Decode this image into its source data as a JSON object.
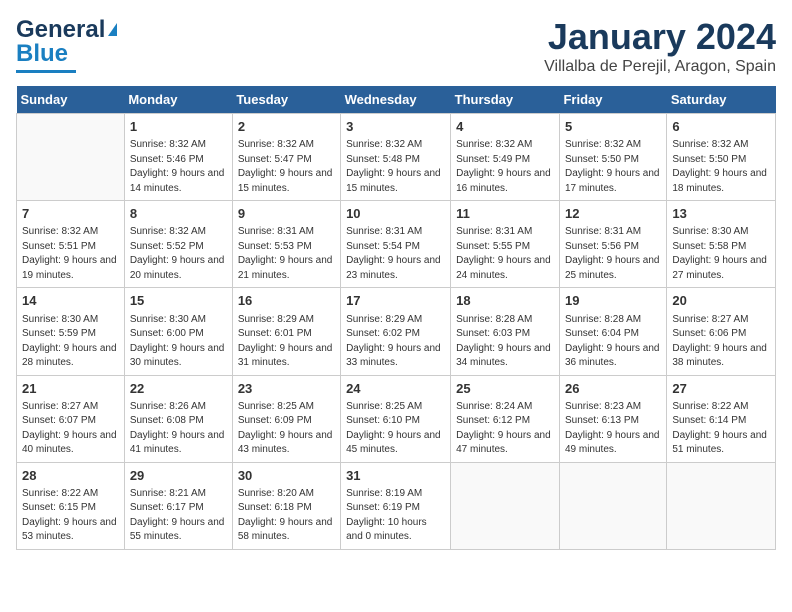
{
  "header": {
    "logo_line1": "General",
    "logo_line2": "Blue",
    "month": "January 2024",
    "location": "Villalba de Perejil, Aragon, Spain"
  },
  "days_of_week": [
    "Sunday",
    "Monday",
    "Tuesday",
    "Wednesday",
    "Thursday",
    "Friday",
    "Saturday"
  ],
  "weeks": [
    [
      {
        "day": "",
        "empty": true
      },
      {
        "day": "1",
        "sunrise": "8:32 AM",
        "sunset": "5:46 PM",
        "daylight": "9 hours and 14 minutes."
      },
      {
        "day": "2",
        "sunrise": "8:32 AM",
        "sunset": "5:47 PM",
        "daylight": "9 hours and 15 minutes."
      },
      {
        "day": "3",
        "sunrise": "8:32 AM",
        "sunset": "5:48 PM",
        "daylight": "9 hours and 15 minutes."
      },
      {
        "day": "4",
        "sunrise": "8:32 AM",
        "sunset": "5:49 PM",
        "daylight": "9 hours and 16 minutes."
      },
      {
        "day": "5",
        "sunrise": "8:32 AM",
        "sunset": "5:50 PM",
        "daylight": "9 hours and 17 minutes."
      },
      {
        "day": "6",
        "sunrise": "8:32 AM",
        "sunset": "5:50 PM",
        "daylight": "9 hours and 18 minutes."
      }
    ],
    [
      {
        "day": "7",
        "sunrise": "8:32 AM",
        "sunset": "5:51 PM",
        "daylight": "9 hours and 19 minutes."
      },
      {
        "day": "8",
        "sunrise": "8:32 AM",
        "sunset": "5:52 PM",
        "daylight": "9 hours and 20 minutes."
      },
      {
        "day": "9",
        "sunrise": "8:31 AM",
        "sunset": "5:53 PM",
        "daylight": "9 hours and 21 minutes."
      },
      {
        "day": "10",
        "sunrise": "8:31 AM",
        "sunset": "5:54 PM",
        "daylight": "9 hours and 23 minutes."
      },
      {
        "day": "11",
        "sunrise": "8:31 AM",
        "sunset": "5:55 PM",
        "daylight": "9 hours and 24 minutes."
      },
      {
        "day": "12",
        "sunrise": "8:31 AM",
        "sunset": "5:56 PM",
        "daylight": "9 hours and 25 minutes."
      },
      {
        "day": "13",
        "sunrise": "8:30 AM",
        "sunset": "5:58 PM",
        "daylight": "9 hours and 27 minutes."
      }
    ],
    [
      {
        "day": "14",
        "sunrise": "8:30 AM",
        "sunset": "5:59 PM",
        "daylight": "9 hours and 28 minutes."
      },
      {
        "day": "15",
        "sunrise": "8:30 AM",
        "sunset": "6:00 PM",
        "daylight": "9 hours and 30 minutes."
      },
      {
        "day": "16",
        "sunrise": "8:29 AM",
        "sunset": "6:01 PM",
        "daylight": "9 hours and 31 minutes."
      },
      {
        "day": "17",
        "sunrise": "8:29 AM",
        "sunset": "6:02 PM",
        "daylight": "9 hours and 33 minutes."
      },
      {
        "day": "18",
        "sunrise": "8:28 AM",
        "sunset": "6:03 PM",
        "daylight": "9 hours and 34 minutes."
      },
      {
        "day": "19",
        "sunrise": "8:28 AM",
        "sunset": "6:04 PM",
        "daylight": "9 hours and 36 minutes."
      },
      {
        "day": "20",
        "sunrise": "8:27 AM",
        "sunset": "6:06 PM",
        "daylight": "9 hours and 38 minutes."
      }
    ],
    [
      {
        "day": "21",
        "sunrise": "8:27 AM",
        "sunset": "6:07 PM",
        "daylight": "9 hours and 40 minutes."
      },
      {
        "day": "22",
        "sunrise": "8:26 AM",
        "sunset": "6:08 PM",
        "daylight": "9 hours and 41 minutes."
      },
      {
        "day": "23",
        "sunrise": "8:25 AM",
        "sunset": "6:09 PM",
        "daylight": "9 hours and 43 minutes."
      },
      {
        "day": "24",
        "sunrise": "8:25 AM",
        "sunset": "6:10 PM",
        "daylight": "9 hours and 45 minutes."
      },
      {
        "day": "25",
        "sunrise": "8:24 AM",
        "sunset": "6:12 PM",
        "daylight": "9 hours and 47 minutes."
      },
      {
        "day": "26",
        "sunrise": "8:23 AM",
        "sunset": "6:13 PM",
        "daylight": "9 hours and 49 minutes."
      },
      {
        "day": "27",
        "sunrise": "8:22 AM",
        "sunset": "6:14 PM",
        "daylight": "9 hours and 51 minutes."
      }
    ],
    [
      {
        "day": "28",
        "sunrise": "8:22 AM",
        "sunset": "6:15 PM",
        "daylight": "9 hours and 53 minutes."
      },
      {
        "day": "29",
        "sunrise": "8:21 AM",
        "sunset": "6:17 PM",
        "daylight": "9 hours and 55 minutes."
      },
      {
        "day": "30",
        "sunrise": "8:20 AM",
        "sunset": "6:18 PM",
        "daylight": "9 hours and 58 minutes."
      },
      {
        "day": "31",
        "sunrise": "8:19 AM",
        "sunset": "6:19 PM",
        "daylight": "10 hours and 0 minutes."
      },
      {
        "day": "",
        "empty": true
      },
      {
        "day": "",
        "empty": true
      },
      {
        "day": "",
        "empty": true
      }
    ]
  ],
  "labels": {
    "sunrise_prefix": "Sunrise: ",
    "sunset_prefix": "Sunset: ",
    "daylight_prefix": "Daylight: "
  }
}
